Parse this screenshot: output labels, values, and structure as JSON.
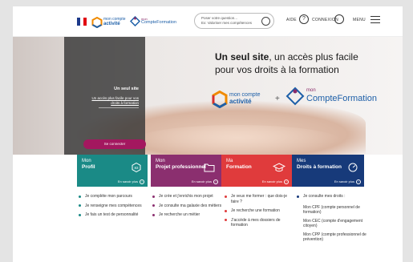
{
  "header": {
    "logo_mca_line1": "mon compte",
    "logo_mca_line2": "activité",
    "logo_mcf_line1": "mon",
    "logo_mcf_line2": "CompteFormation",
    "search_placeholder_1": "Poser votre question...",
    "search_placeholder_2": "Ex: Valoriser mes compétences",
    "aide_label": "AIDE",
    "connexion_label": "CONNEXION",
    "menu_label": "MENU",
    "icon_names": [
      "marianne-logo",
      "search-icon",
      "help-icon",
      "user-icon",
      "hamburger-icon"
    ]
  },
  "hero": {
    "headline_bold": "Un seul site",
    "headline_rest": ", un accès plus facile",
    "headline_line2": "pour vos droits à la formation",
    "panel_title": "Un seul site",
    "panel_sub_1": "Un accès plus facile pour vos",
    "panel_sub_2": "droits à formation",
    "login_button": "Se connecter",
    "plus_sign": "+"
  },
  "tiles": [
    {
      "line1": "Mon",
      "line2": "Profil",
      "more": "En savoir plus",
      "color": "#1a8a86",
      "icon": "profile-badge-icon"
    },
    {
      "line1": "Mon",
      "line2": "Projet professionnel",
      "more": "En savoir plus",
      "color": "#8b2f6f",
      "icon": "folder-icon"
    },
    {
      "line1": "Ma",
      "line2": "Formation",
      "more": "En savoir plus",
      "color": "#e03b3c",
      "icon": "graduation-cap-icon"
    },
    {
      "line1": "Mes",
      "line2": "Droits à formation",
      "more": "En savoir plus",
      "color": "#173a7a",
      "icon": "gauge-icon"
    }
  ],
  "lists": [
    {
      "dot_color": "#1a8a86",
      "items": [
        "Je complète mon parcours",
        "Je renseigne mes compétences",
        "Je fais un test de personnalité"
      ]
    },
    {
      "dot_color": "#8b2f6f",
      "items": [
        "Je crée et j'enrichis mon projet",
        "Je consulte ma galaxie des métiers",
        "Je recherche un métier"
      ]
    },
    {
      "dot_color": "#e03b3c",
      "items": [
        "Je veux me former : que dois-je faire ?",
        "Je recherche une formation",
        "J'accède à mes dossiers de formation"
      ]
    },
    {
      "dot_color": "#173a7a",
      "items": [
        "Je consulte mes droits :"
      ],
      "subs": [
        "Mon CPF (compte personnel de formation)",
        "Mon CEC (compte d'engagement citoyen)",
        "Mon CPP (compte professionnel de prévention)"
      ]
    }
  ]
}
